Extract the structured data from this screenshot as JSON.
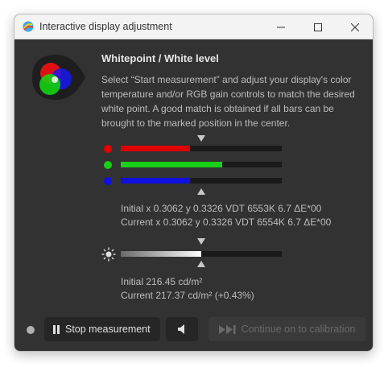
{
  "window": {
    "title": "Interactive display adjustment"
  },
  "main": {
    "heading": "Whitepoint / White level",
    "description": "Select “Start measurement” and adjust your display's color temperature and/or RGB gain controls to match the desired white point. A good match is obtained if all bars can be brought to the marked position in the center."
  },
  "rgb_bars": {
    "red": {
      "color": "#e00000",
      "level": 0.43
    },
    "green": {
      "color": "#18d018",
      "level": 0.63
    },
    "blue": {
      "color": "#1010e0",
      "level": 0.43
    },
    "initial": "Initial x 0.3062 y 0.3326 VDT 6553K 6.7 ΔE*00",
    "current": "Current x 0.3062 y 0.3326 VDT 6554K 6.7 ΔE*00"
  },
  "luminance": {
    "level": 0.5,
    "initial": "Initial 216.45 cd/m²",
    "current": "Current 217.37 cd/m² (+0.43%)"
  },
  "buttons": {
    "stop": "Stop measurement",
    "continue": "Continue on to calibration"
  },
  "icons": {
    "app": "displaycal-icon",
    "pause": "pause-icon",
    "speaker": "speaker-icon",
    "skip": "skip-forward-icon",
    "sun": "brightness-icon"
  }
}
